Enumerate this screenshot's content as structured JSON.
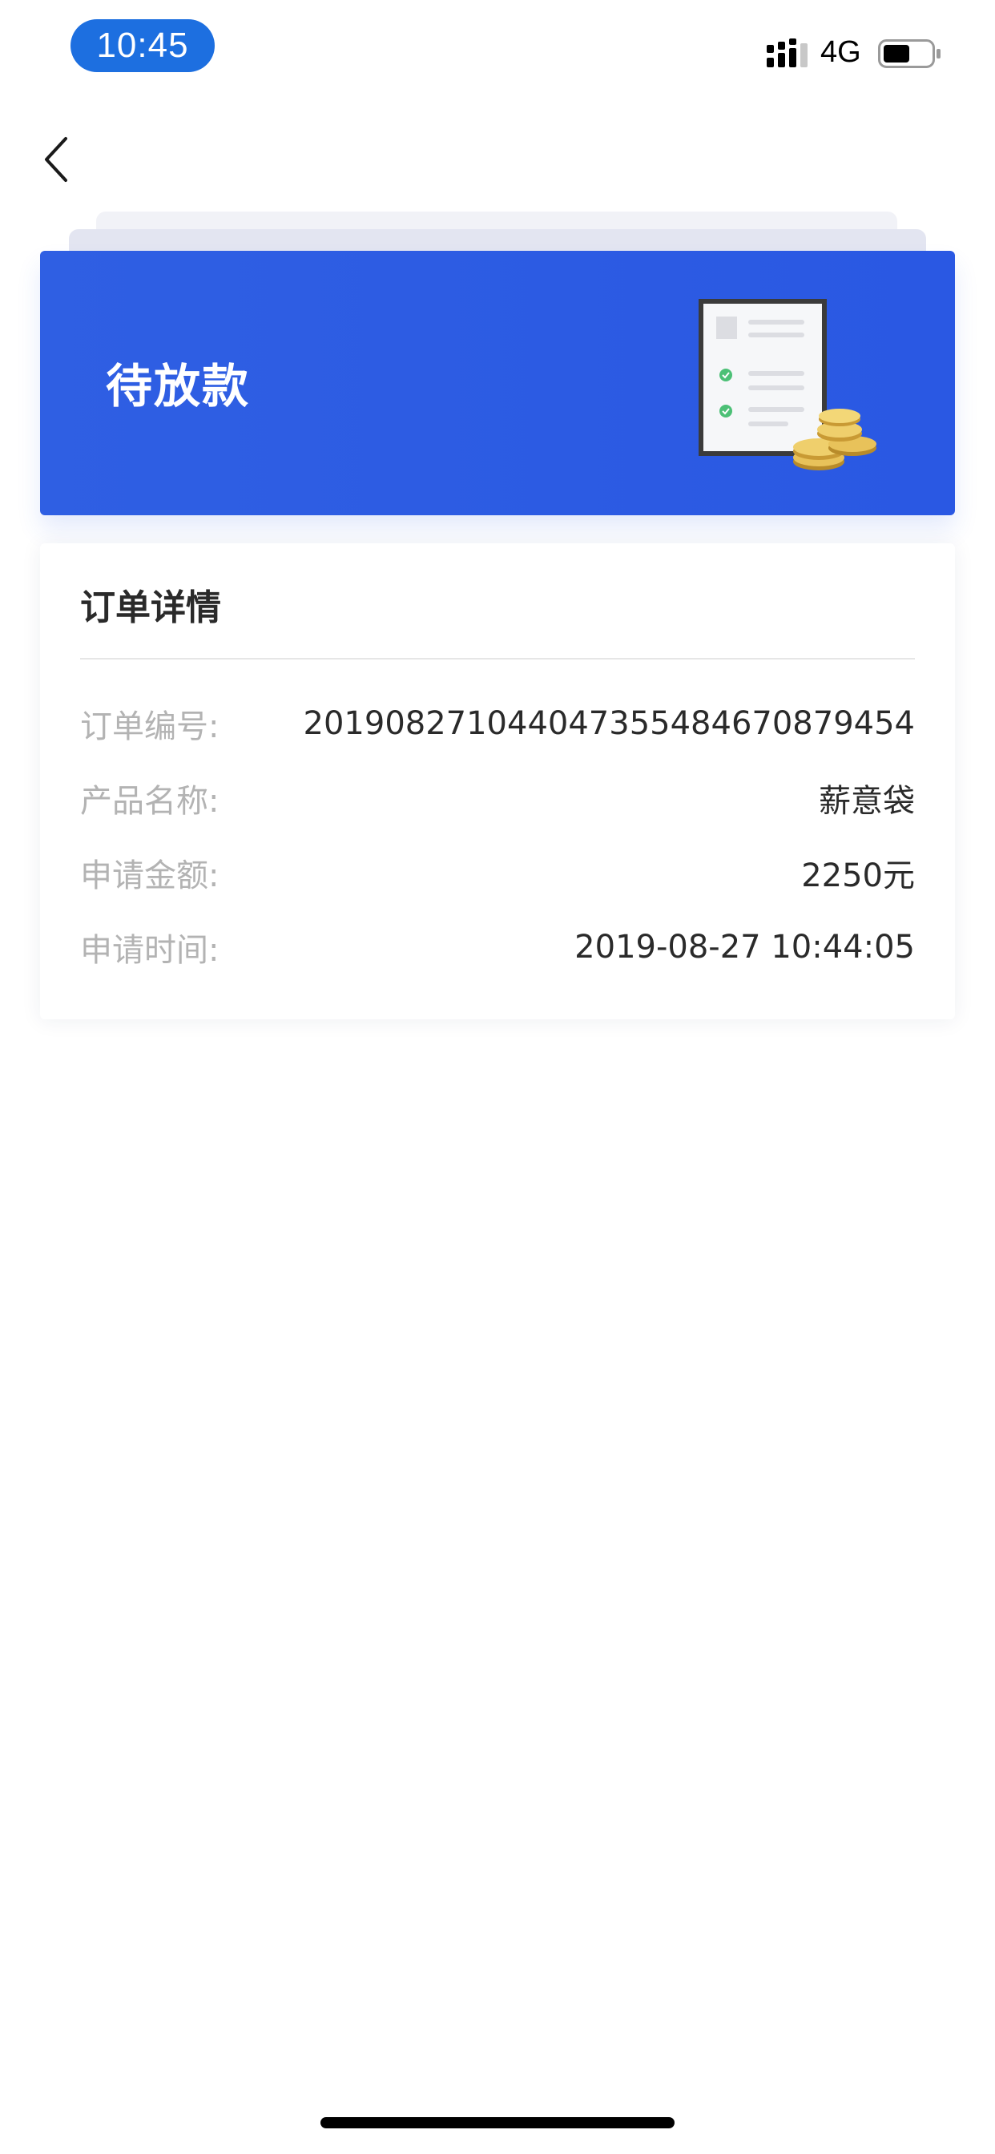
{
  "status_bar": {
    "time": "10:45",
    "network": "4G",
    "icons": [
      "signal-icon",
      "battery-icon"
    ]
  },
  "nav": {
    "back_icon": "chevron-left-icon"
  },
  "banner": {
    "status_title": "待放款",
    "illustration": "document-with-coins-icon",
    "color": "#2a58e3"
  },
  "order_details": {
    "title": "订单详情",
    "rows": [
      {
        "label": "订单编号:",
        "value": "20190827104404735548467087945​4"
      },
      {
        "label": "产品名称:",
        "value": "薪意袋"
      },
      {
        "label": "申请金额:",
        "value": "2250元"
      },
      {
        "label": "申请时间:",
        "value": "2019-08-27 10:44:05"
      }
    ]
  },
  "colors": {
    "accent": "#2a58e3",
    "time_pill": "#1d6fe0",
    "label_text": "#b3b3b3",
    "value_text": "#2a2a2a"
  }
}
